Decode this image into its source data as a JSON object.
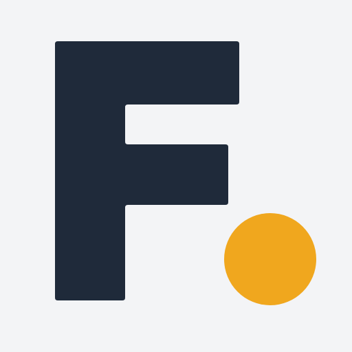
{
  "logo": {
    "letter": "F",
    "colors": {
      "background": "#F3F4F6",
      "letter": "#1F2A3A",
      "dot": "#F0A71E"
    }
  }
}
